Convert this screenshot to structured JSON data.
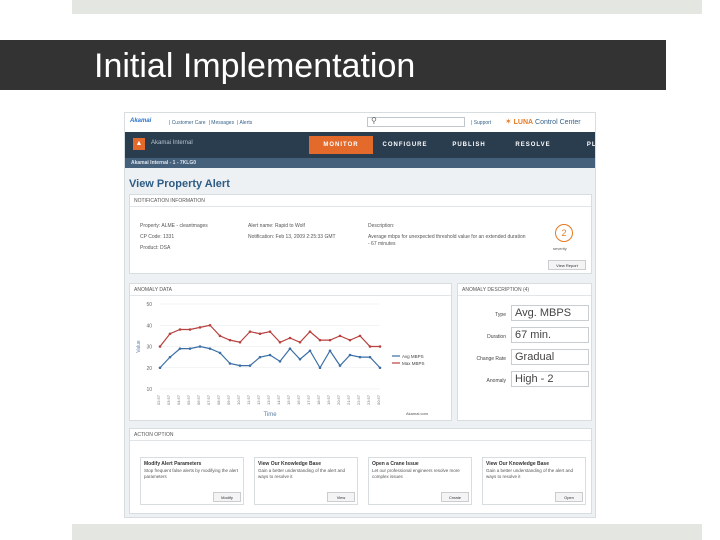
{
  "slide": {
    "title": "Initial Implementation"
  },
  "topbar": {
    "logo": "Akamai",
    "links": [
      "| Customer Care",
      "| Messages",
      "| Alerts"
    ],
    "support": "| Support",
    "brand_prefix": "LUNA",
    "brand_suffix": " Control Center",
    "search_icon": "search-icon"
  },
  "nav": {
    "account_name": "Akamai Internal",
    "account_icon": "account-icon",
    "tabs": [
      "MONITOR",
      "CONFIGURE",
      "PUBLISH",
      "RESOLVE",
      "PLAN"
    ],
    "active_tab": "MONITOR",
    "breadcrumb": "Akamai Internal - 1 - 7KLG0",
    "colors": {
      "nav_bg": "#2a3d4f",
      "accent": "#e46a2c",
      "title": "#2e5c84"
    }
  },
  "page": {
    "title": "View Property Alert"
  },
  "notification": {
    "header": "NOTIFICATION INFORMATION",
    "col1": [
      "Property: ALME - cleantmages",
      "CP Code: 1331",
      "Product: DSA"
    ],
    "col2": [
      "Alert name: Rapid to Wolf",
      "Notification: Feb 13, 2009 2:25:33 GMT"
    ],
    "col3_title": "Description:",
    "col3_text": "Average mbps for unexpected threshold value for an extended duration - 67 minutes",
    "severity_value": "2",
    "severity_label": "severity",
    "view_button": "View Report"
  },
  "anomaly_data": {
    "header": "ANOMALY DATA",
    "footer": "Akamai.com"
  },
  "anomaly_description": {
    "header": "ANOMALY DESCRIPTION (4)",
    "fields": [
      {
        "label": "Type",
        "value": "Avg. MBPS"
      },
      {
        "label": "Duration",
        "value": "67 min."
      },
      {
        "label": "Change Rate",
        "value": "Gradual"
      },
      {
        "label": "Anomaly",
        "value": "High - 2"
      }
    ]
  },
  "action_option": {
    "header": "ACTION OPTION",
    "cards": [
      {
        "title": "Modify Alert Parameters",
        "desc": "Stop frequent false alerts by modifying the alert parameters",
        "button": "Modify"
      },
      {
        "title": "View Our Knowledge Base",
        "desc": "Gain a better understanding of the alert and ways to resolve it",
        "button": "View"
      },
      {
        "title": "Open a Crane Issue",
        "desc": "Let our professional engineers resolve more complex issues",
        "button": "Create"
      },
      {
        "title": "View Our Knowledge Base",
        "desc": "Gain a better understanding of the alert and ways to resolve it",
        "button": "Open"
      }
    ]
  },
  "chart_data": {
    "type": "line",
    "title": "",
    "xlabel": "Time",
    "ylabel": "Value",
    "ylim": [
      10,
      50
    ],
    "yticks": [
      10,
      20,
      30,
      40,
      50
    ],
    "x": [
      "02:57",
      "03:57",
      "04:57",
      "05:57",
      "06:57",
      "07:57",
      "08:57",
      "09:57",
      "10:57",
      "11:57",
      "12:57",
      "13:57",
      "14:57",
      "15:57",
      "16:57",
      "17:57",
      "18:57",
      "19:57",
      "20:57",
      "21:57",
      "22:57",
      "23:57",
      "00:57"
    ],
    "legend_placement": "right",
    "series": [
      {
        "name": "Avg MBPS",
        "color": "#3a6ea5",
        "values": [
          20,
          25,
          29,
          29,
          30,
          29,
          27,
          22,
          21,
          21,
          25,
          26,
          23,
          29,
          24,
          28,
          20,
          28,
          21,
          26,
          25,
          25,
          20
        ]
      },
      {
        "name": "Max MBPS",
        "color": "#b8403e",
        "values": [
          30,
          36,
          38,
          38,
          39,
          40,
          35,
          33,
          32,
          37,
          36,
          37,
          32,
          34,
          32,
          37,
          33,
          33,
          35,
          33,
          35,
          30,
          30
        ]
      }
    ]
  }
}
